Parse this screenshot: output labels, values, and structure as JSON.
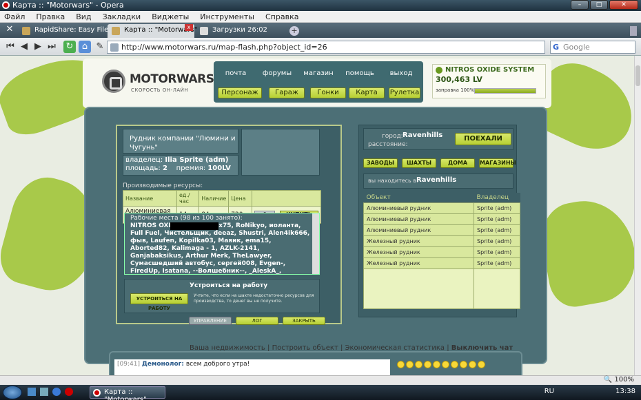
{
  "window": {
    "title": "Карта :: \"Motorwars\" - Opera"
  },
  "menu": [
    "Файл",
    "Правка",
    "Вид",
    "Закладки",
    "Виджеты",
    "Инструменты",
    "Справка"
  ],
  "tabs": [
    {
      "label": "RapidShare: Easy Fileh..."
    },
    {
      "label": "Карта :: \"Motorwars\""
    },
    {
      "label": "Загрузки 26:02"
    }
  ],
  "address": {
    "url": "http://www.motorwars.ru/map-flash.php?object_id=26",
    "search_placeholder": "Google"
  },
  "site": {
    "logo": "MOTORWARS.RU",
    "tagline": "СКОРОСТЬ ОН-ЛАЙН",
    "top_links": [
      "почта",
      "форумы",
      "магазин",
      "помощь",
      "выход"
    ],
    "nav_buttons": [
      "Персонаж",
      "Гараж",
      "Гонки",
      "Карта",
      "Рулетка"
    ],
    "system": {
      "name": "NITROS OXIDE SYSTEM",
      "balance": "300,463 LV",
      "fuel_label": "заправка 100%",
      "fuel_percent": 100
    }
  },
  "mine": {
    "title": "Рудник компании \"Люмини и Чугунь\"",
    "owner_label": "владелец:",
    "owner": "Ilia Sprite (adm)",
    "area_label": "площадь:",
    "area": "2",
    "bonus_label": "премия:",
    "bonus": "100LV",
    "resources_label": "Производимые ресурсы:",
    "table_headers": [
      "Название",
      "ед./час",
      "Наличие",
      "Цена",
      ""
    ],
    "table_rows": [
      {
        "name": "Алюминиевая руда",
        "per_hour": "14",
        "stock": "84",
        "price": "720",
        "qty": "0",
        "buy": "КУПИТЬ"
      }
    ],
    "workplaces_label": "Рабочие места (98 из 100 занято):",
    "workers": "NITROS OXIDE, Sunlight, x75, RoNikyo, иоланта, Full Fuel, Чистельщик, deeaz, Shustri, Alen4ik666, фыв, Laufen, Kopilka03, Маяик, ema15, Aborted82, Kalimaga - 1, AZLK-2141, Ganjabaksikus, Arthur Merk, TheLawyer, Сумасшедший автобус, сергей008, Evgen-, FiredUp, Isatana, --Волшебник--, _AleskA_, Andrewrr, rbhome, Ahmet, Деляга, Oldpank, Андрон БОНД, KARTVELi,",
    "employ_title": "Устроиться на работу",
    "employ_button": "УСТРОИТЬСЯ НА РАБОТУ",
    "employ_note": "Учтите, что если на шахте недостаточно ресурсов для производства, то денег вы не получите.",
    "bottom_buttons": [
      "УПРАВЛЕНИЕ",
      "ЛОГ",
      "ЗАКРЫТЬ"
    ]
  },
  "city": {
    "city_label": "город:",
    "city": "Ravenhills",
    "distance_label": "расстояние:",
    "go_button": "ПОЕХАЛИ",
    "categories": [
      "ЗАВОДЫ",
      "ШАХТЫ",
      "ДОМА",
      "МАГАЗИНЫ"
    ],
    "here_label": "вы находитесь в:",
    "here": "Ravenhills",
    "columns": [
      "Объект",
      "Владелец"
    ],
    "objects": [
      {
        "name": "Алюминиевый рудник",
        "owner": "Sprite (adm)"
      },
      {
        "name": "Алюминиевый рудник",
        "owner": "Sprite (adm)"
      },
      {
        "name": "Алюминиевый рудник",
        "owner": "Sprite (adm)"
      },
      {
        "name": "Железный рудник",
        "owner": "Sprite (adm)"
      },
      {
        "name": "Железный рудник",
        "owner": "Sprite (adm)"
      },
      {
        "name": "Железный рудник",
        "owner": "Sprite (adm)"
      }
    ]
  },
  "footer_links": [
    "Ваша недвижимость",
    "Построить объект",
    "Экономическая статистика",
    "Выключить чат"
  ],
  "chat": {
    "time": "[09:41]",
    "user": "Демонолог:",
    "message": "всем доброго утра!"
  },
  "status": {
    "zoom": "100%"
  },
  "taskbar": {
    "item": "Карта :: \"Motorwars\"...",
    "lang": "RU",
    "clock": "13:38"
  }
}
